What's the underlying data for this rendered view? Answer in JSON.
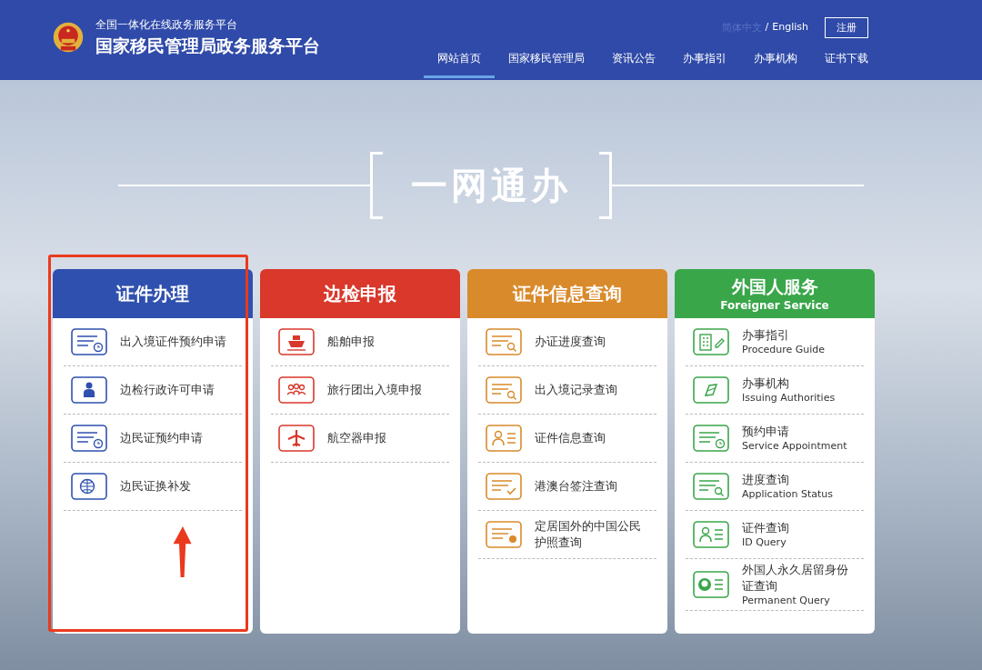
{
  "header": {
    "subtitle": "全国一体化在线政务服务平台",
    "title": "国家移民管理局政务服务平台",
    "languages": [
      {
        "label": "简体中文",
        "selected": true
      },
      {
        "label": "English",
        "selected": false
      }
    ],
    "separator": "/",
    "register_button": "注册",
    "nav": [
      {
        "label": "网站首页",
        "selected": true
      },
      {
        "label": "国家移民管理局",
        "selected": false
      },
      {
        "label": "资讯公告",
        "selected": false
      },
      {
        "label": "办事指引",
        "selected": false
      },
      {
        "label": "办事机构",
        "selected": false
      },
      {
        "label": "证书下载",
        "selected": false
      }
    ]
  },
  "hero": {
    "title": "一网通办"
  },
  "cards": [
    {
      "title": "证件办理",
      "color": "#2f50ae",
      "highlighted": true,
      "items": [
        {
          "kind": "clock-card",
          "label": "出入境证件预约申请"
        },
        {
          "kind": "person-card",
          "label": "边检行政许可申请"
        },
        {
          "kind": "clock-card",
          "label": "边民证预约申请"
        },
        {
          "kind": "globe-card",
          "label": "边民证换补发"
        }
      ]
    },
    {
      "title": "边检申报",
      "color": "#d9382b",
      "highlighted": false,
      "items": [
        {
          "kind": "ship-card",
          "label": "船舶申报"
        },
        {
          "kind": "group-card",
          "label": "旅行团出入境申报"
        },
        {
          "kind": "plane-card",
          "label": "航空器申报"
        }
      ]
    },
    {
      "title": "证件信息查询",
      "color": "#d98a2b",
      "highlighted": false,
      "items": [
        {
          "kind": "search-card",
          "label": "办证进度查询"
        },
        {
          "kind": "search-card",
          "label": "出入境记录查询"
        },
        {
          "kind": "id-card",
          "label": "证件信息查询"
        },
        {
          "kind": "check-card",
          "label": "港澳台签注查询"
        },
        {
          "kind": "passport-card",
          "label": "定居国外的中国公民护照查询"
        }
      ]
    },
    {
      "title": "外国人服务",
      "subtitle": "Foreigner Service",
      "color": "#3aa64a",
      "highlighted": false,
      "items": [
        {
          "kind": "building-card",
          "label": "办事指引",
          "sublabel": "Procedure Guide"
        },
        {
          "kind": "compass-card",
          "label": "办事机构",
          "sublabel": "Issuing Authorities"
        },
        {
          "kind": "clock-card",
          "label": "预约申请",
          "sublabel": "Service Appointment"
        },
        {
          "kind": "search-card",
          "label": "进度查询",
          "sublabel": "Application Status"
        },
        {
          "kind": "id-card",
          "label": "证件查询",
          "sublabel": "ID Query"
        },
        {
          "kind": "face-card",
          "label": "外国人永久居留身份证查询",
          "sublabel": "Permanent Query"
        }
      ]
    }
  ]
}
